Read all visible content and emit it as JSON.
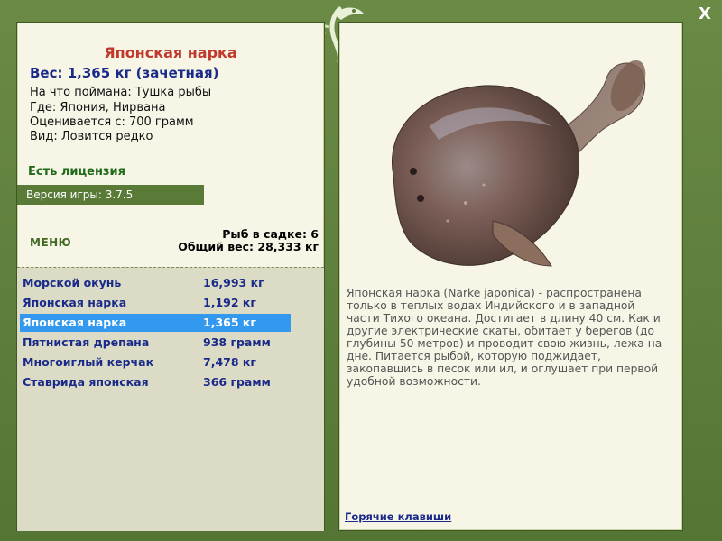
{
  "fish": {
    "title": "Японская нарка",
    "weight_line": "Вес: 1,365 кг (зачетная)",
    "caught_on": "На что поймана: Тушка рыбы",
    "location": "Где: Япония, Нирвана",
    "valued_from": "Оценивается с: 700 грамм",
    "kind": "Вид: Ловится редко",
    "description": "Японская нарка (Narke japonica) - распространена только в теплых водах Индийского и в западной части Тихого океана. Достигает в длину 40 см. Как и другие электрические скаты, обитает у берегов (до глубины 50 метров) и проводит свою жизнь, лежа на дне. Питается рыбой, которую поджидает, закопавшись в песок или ил, и оглушает при первой удобной возможности."
  },
  "status": {
    "license": "Есть лицензия",
    "version": "Версия игры: 3.7.5"
  },
  "menu_label": "МЕНЮ",
  "cage": {
    "count_line": "Рыб в садке: 6",
    "total_line": "Общий вес: 28,333 кг"
  },
  "catch_list": [
    {
      "name": "Морской окунь",
      "weight": "16,993 кг"
    },
    {
      "name": "Японская нарка",
      "weight": "1,192 кг"
    },
    {
      "name": "Японская нарка",
      "weight": "1,365 кг"
    },
    {
      "name": "Пятнистая дрепана",
      "weight": "938 грамм"
    },
    {
      "name": "Многоиглый керчак",
      "weight": "7,478 кг"
    },
    {
      "name": "Ставрида японская",
      "weight": "366 грамм"
    }
  ],
  "selected_index": 2,
  "hotkeys_link": "Горячие клавиши",
  "close_label": "X",
  "icons": {
    "close": "close-icon",
    "emblem": "fish-emblem-icon"
  },
  "colors": {
    "title": "#c0392b",
    "weight": "#1a2a8a",
    "selected_row": "#3399ee",
    "frame": "#5b7a3a"
  }
}
